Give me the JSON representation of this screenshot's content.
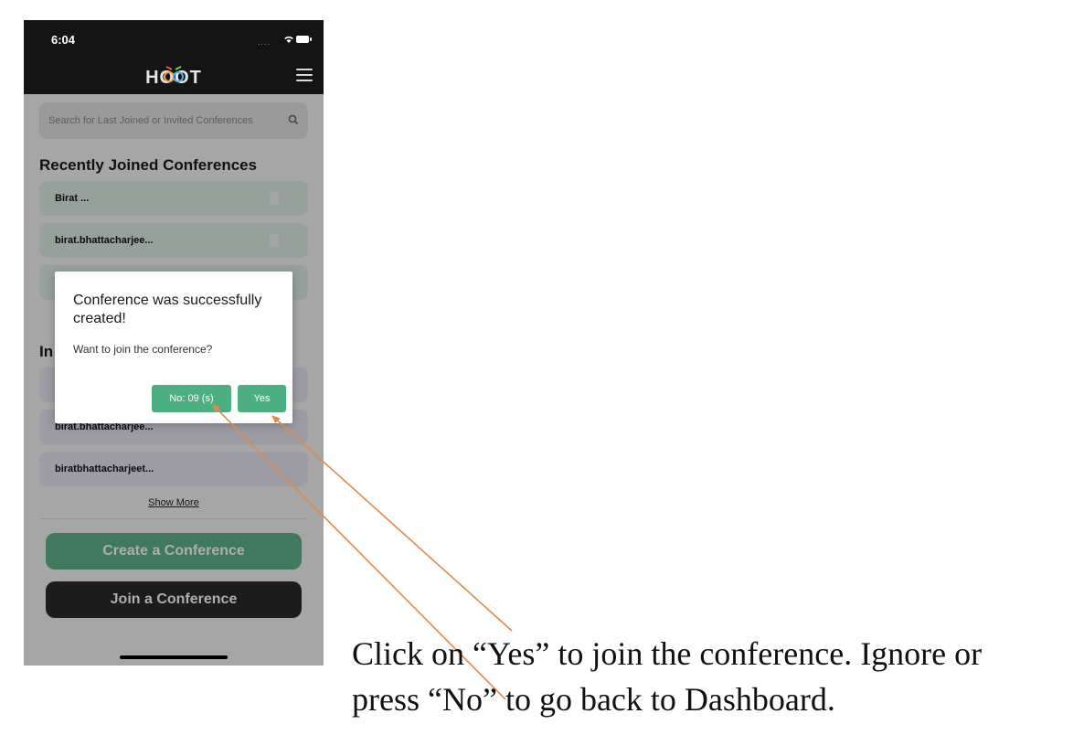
{
  "status_bar": {
    "time": "6:04",
    "signal_dots": "...."
  },
  "header": {
    "logo_text": "HOOT"
  },
  "search": {
    "placeholder": "Search for Last Joined or Invited Conferences"
  },
  "recent": {
    "title": "Recently Joined Conferences",
    "items": [
      "Birat ...",
      "birat.bhattacharjee...",
      ""
    ]
  },
  "invited": {
    "title": "In",
    "items": [
      "",
      "birat.bhattacharjee...",
      "biratbhattacharjeet..."
    ]
  },
  "show_more": "Show More",
  "buttons": {
    "create": "Create a Conference",
    "join": "Join a Conference"
  },
  "dialog": {
    "title": "Conference was successfully created!",
    "message": "Want to join the conference?",
    "no_label": "No:  09 (s)",
    "yes_label": "Yes"
  },
  "caption": {
    "line1": "Click on “Yes” to join the conference. Ignore or",
    "line2": "press “No” to go back to Dashboard."
  },
  "colors": {
    "accent_green": "#4caf82",
    "annotation_arrow": "#e08a4a",
    "header_bg": "#141414"
  },
  "icons": [
    "wifi-icon",
    "battery-icon",
    "hamburger-menu-icon",
    "search-icon",
    "trash-icon"
  ]
}
